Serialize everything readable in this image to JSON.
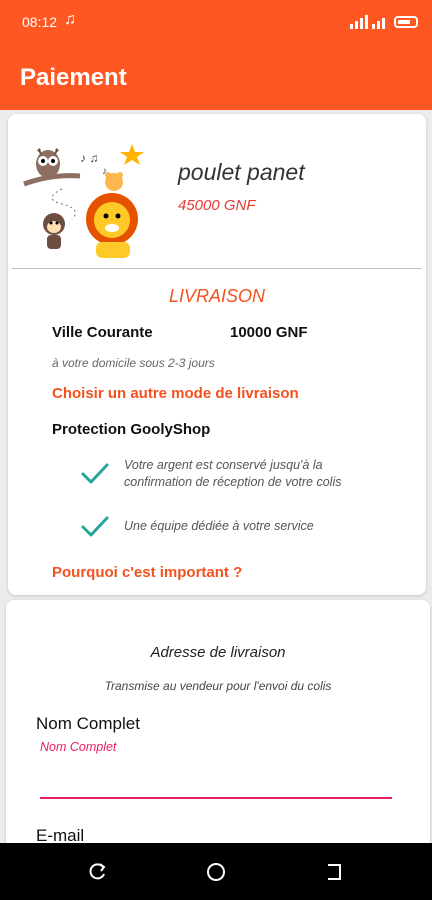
{
  "status_bar": {
    "time": "08:12",
    "music_icon": "music-note-icon",
    "signal_icon": "signal-icon",
    "battery_icon": "battery-icon"
  },
  "app_bar": {
    "title": "Paiement"
  },
  "product": {
    "image": "cartoon-animals-image",
    "name": "poulet panet",
    "price": "45000 GNF"
  },
  "livraison": {
    "header": "LIVRAISON",
    "location": "Ville Courante",
    "price": "10000 GNF",
    "delay": "à votre domicile sous 2-3 jours",
    "change_link": "Choisir un autre mode de livraison"
  },
  "protection": {
    "title": "Protection GoolyShop",
    "benefits": [
      "Votre argent est conservé jusqu'à la confirmation de réception de votre colis",
      "Une équipe dédiée à votre service"
    ],
    "why_link": "Pourquoi c'est important ?"
  },
  "address": {
    "title": "Adresse de livraison",
    "subtitle": "Transmise au vendeur pour l'envoi du colis",
    "name_label": "Nom Complet",
    "name_placeholder": "Nom Complet",
    "name_value": "",
    "email_label": "E-mail"
  },
  "colors": {
    "primary": "#ff5722",
    "accent_orange": "#f4511e",
    "price_red": "#e53935",
    "input_pink": "#e91e63",
    "check_green": "#26a69a"
  },
  "nav_bar": [
    "back-icon",
    "home-icon",
    "recent-apps-icon"
  ]
}
